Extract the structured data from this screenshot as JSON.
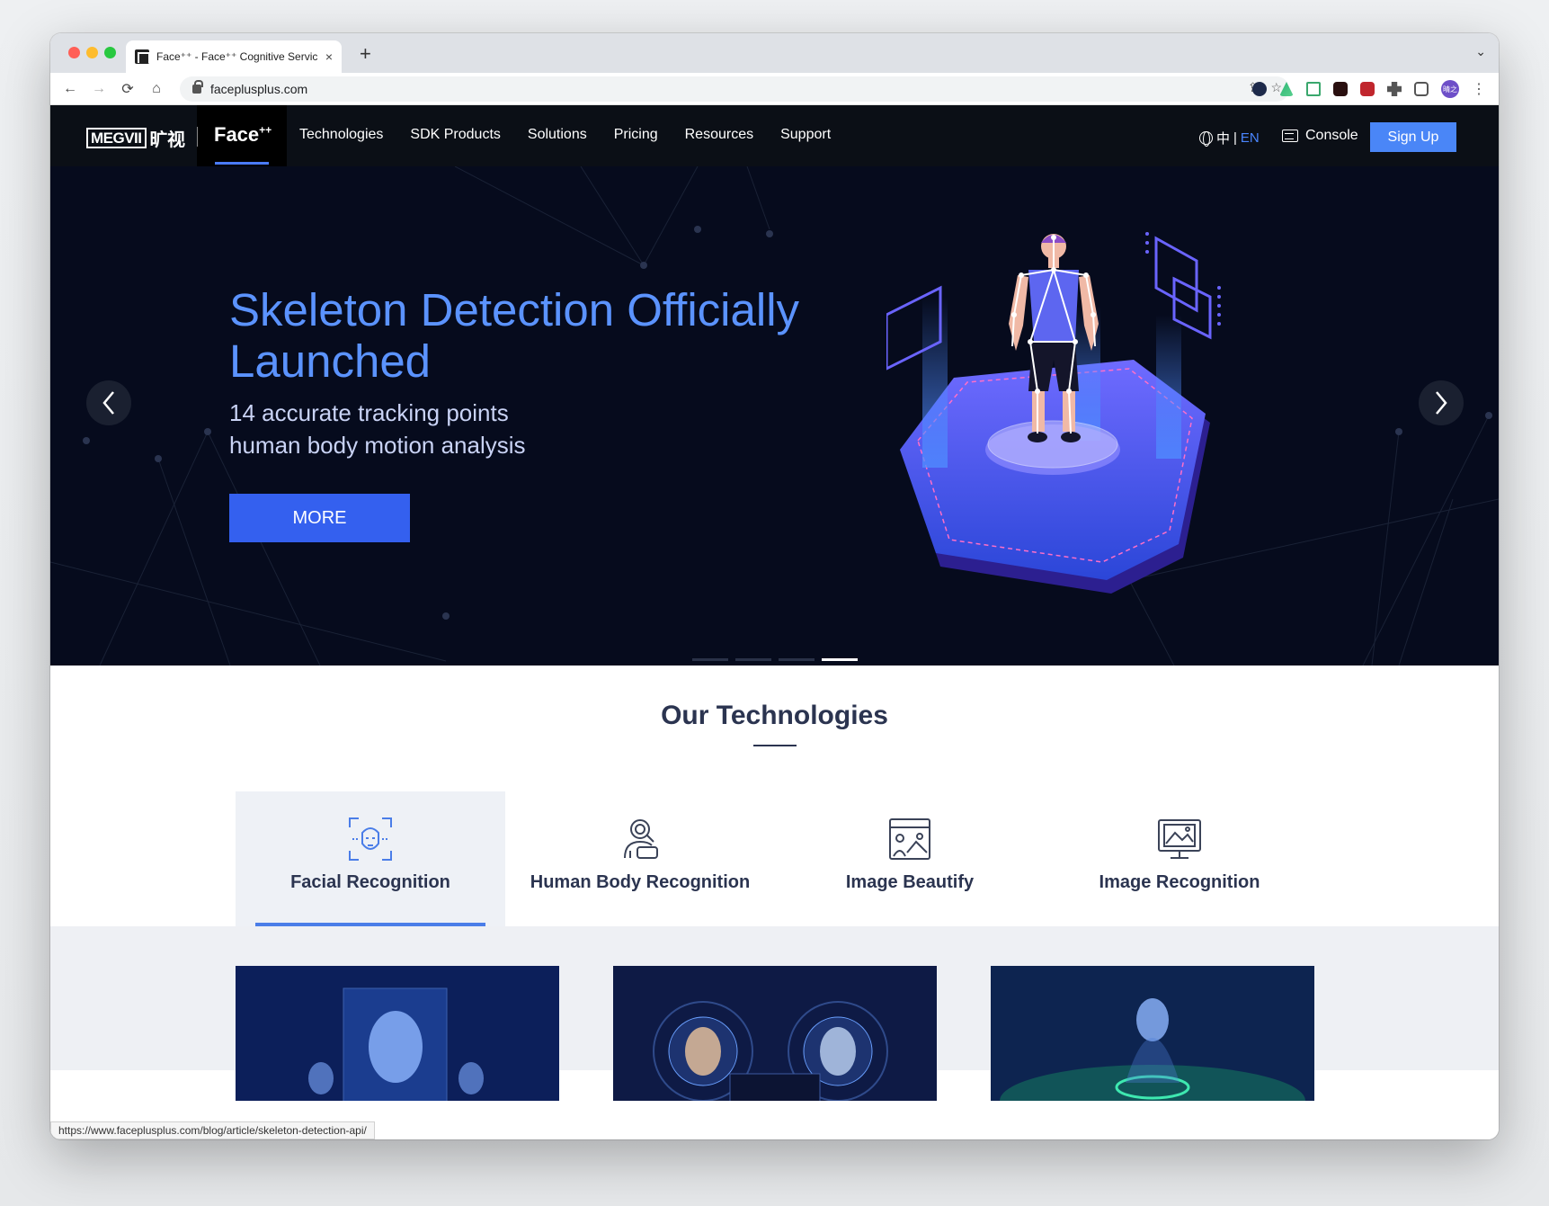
{
  "browser": {
    "tab_title": "Face⁺⁺ - Face⁺⁺ Cognitive Servic",
    "close": "×",
    "new_tab": "+",
    "tab_menu": "⌄",
    "url": "faceplusplus.com",
    "back": "←",
    "forward": "→",
    "reload": "⟳",
    "home": "⌂",
    "share": "⇪",
    "star": "☆",
    "kebab": "⋮",
    "avatar_text": "晴之",
    "status_url": "https://www.faceplusplus.com/blog/article/skeleton-detection-api/"
  },
  "header": {
    "megvii": "MEGVII",
    "megvii_cn": "旷视",
    "faceplus": "Face",
    "faceplus_sup": "++",
    "nav": [
      "Technologies",
      "SDK Products",
      "Solutions",
      "Pricing",
      "Resources",
      "Support"
    ],
    "lang_cn": "中",
    "lang_sep": "|",
    "lang_en": "EN",
    "console": "Console",
    "signup": "Sign Up"
  },
  "hero": {
    "title": "Skeleton Detection Officially Launched",
    "sub_line1": "14 accurate tracking points",
    "sub_line2": "human body motion analysis",
    "more": "MORE",
    "slide_count": 4,
    "active_slide": 4
  },
  "technologies": {
    "title": "Our Technologies",
    "tabs": [
      {
        "label": "Facial Recognition",
        "icon": "face-scan-icon",
        "active": true
      },
      {
        "label": "Human Body Recognition",
        "icon": "body-recognition-icon",
        "active": false
      },
      {
        "label": "Image Beautify",
        "icon": "image-beautify-icon",
        "active": false
      },
      {
        "label": "Image Recognition",
        "icon": "image-recognition-icon",
        "active": false
      }
    ]
  },
  "colors": {
    "header_bg": "#0b0f16",
    "hero_bg": "#060b1d",
    "accent": "#4a86f7",
    "hero_title": "#5b93ff",
    "more_btn": "#3460ef"
  }
}
